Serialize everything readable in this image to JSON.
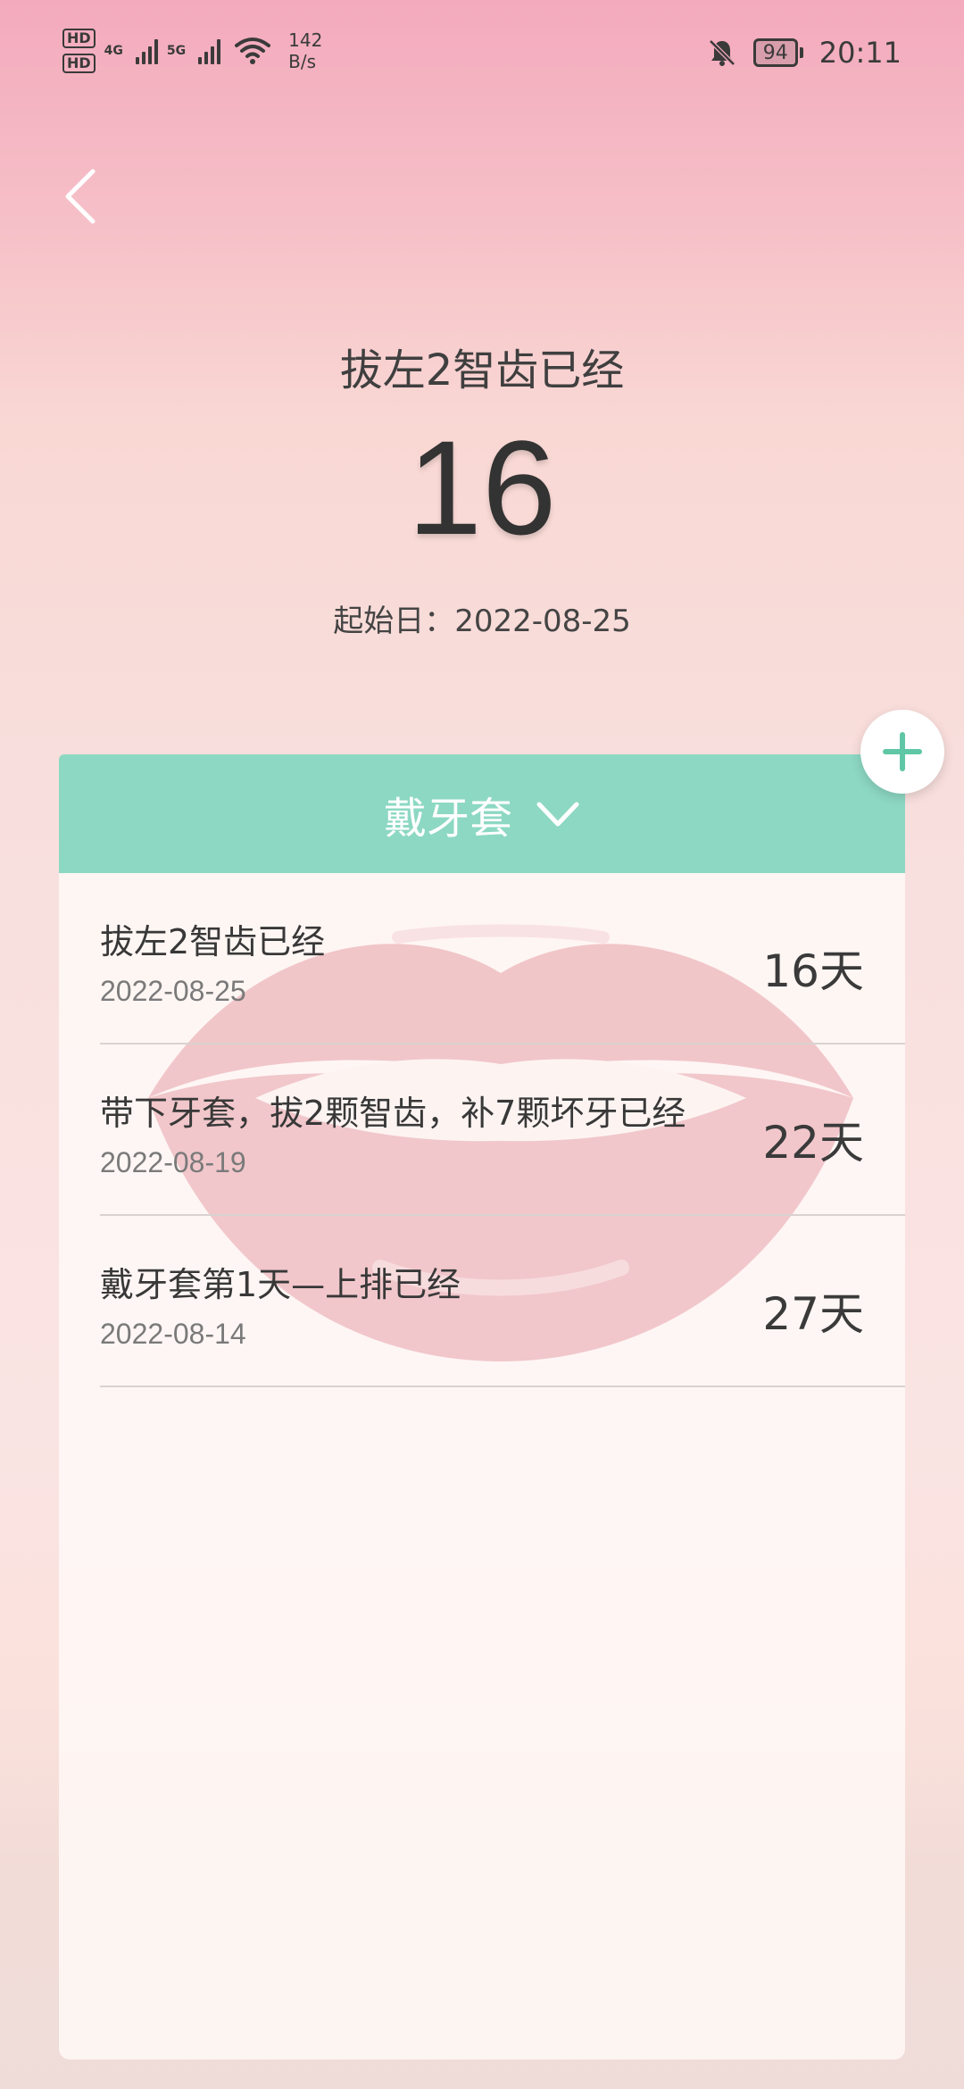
{
  "status_bar": {
    "hd1": "HD",
    "hd2": "HD",
    "sim1_type": "4G",
    "sim2_type": "5G",
    "speed_value": "142",
    "speed_unit": "B/s",
    "battery": "94",
    "time": "20:11"
  },
  "header": {
    "title": "拔左2智齿已经",
    "days": "16",
    "start_label": "起始日：",
    "start_date": "2022-08-25"
  },
  "card": {
    "category": "戴牙套",
    "accent_color": "#8dd8c3",
    "items": [
      {
        "title": "拔左2智齿已经",
        "date": "2022-08-25",
        "days": "16天"
      },
      {
        "title": "带下牙套，拔2颗智齿，补7颗坏牙已经",
        "date": "2022-08-19",
        "days": "22天"
      },
      {
        "title": "戴牙套第1天—上排已经",
        "date": "2022-08-14",
        "days": "27天"
      }
    ]
  }
}
